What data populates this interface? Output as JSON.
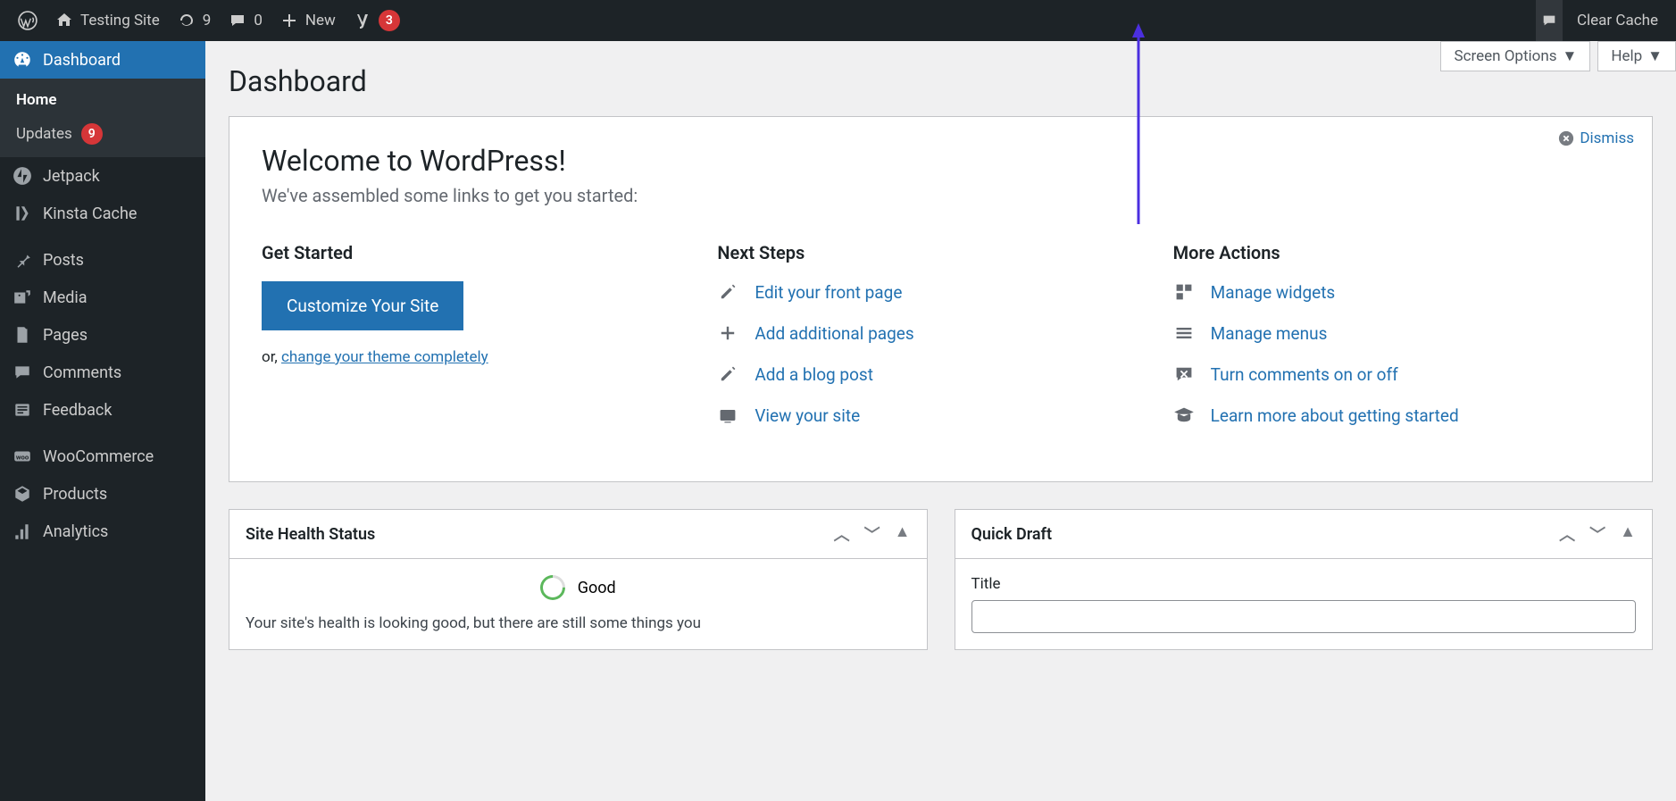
{
  "topbar": {
    "site_name": "Testing Site",
    "updates_count": "9",
    "comments_count": "0",
    "new_label": "New",
    "yoast_count": "3",
    "clear_cache": "Clear Cache"
  },
  "page_controls": {
    "screen_options": "Screen Options",
    "help": "Help"
  },
  "page_title": "Dashboard",
  "sidebar": {
    "dashboard": "Dashboard",
    "home": "Home",
    "updates": "Updates",
    "updates_count": "9",
    "jetpack": "Jetpack",
    "kinsta_cache": "Kinsta Cache",
    "posts": "Posts",
    "media": "Media",
    "pages": "Pages",
    "comments": "Comments",
    "feedback": "Feedback",
    "woocommerce": "WooCommerce",
    "products": "Products",
    "analytics": "Analytics"
  },
  "welcome": {
    "dismiss": "Dismiss",
    "title": "Welcome to WordPress!",
    "subtitle": "We've assembled some links to get you started:",
    "get_started": {
      "heading": "Get Started",
      "customize_btn": "Customize Your Site",
      "or_prefix": "or, ",
      "change_theme": "change your theme completely"
    },
    "next_steps": {
      "heading": "Next Steps",
      "items": [
        "Edit your front page",
        "Add additional pages",
        "Add a blog post",
        "View your site"
      ]
    },
    "more_actions": {
      "heading": "More Actions",
      "items": [
        "Manage widgets",
        "Manage menus",
        "Turn comments on or off",
        "Learn more about getting started"
      ]
    }
  },
  "metaboxes": {
    "site_health": {
      "title": "Site Health Status",
      "status": "Good",
      "description": "Your site's health is looking good, but there are still some things you"
    },
    "quick_draft": {
      "title": "Quick Draft",
      "title_label": "Title"
    }
  }
}
